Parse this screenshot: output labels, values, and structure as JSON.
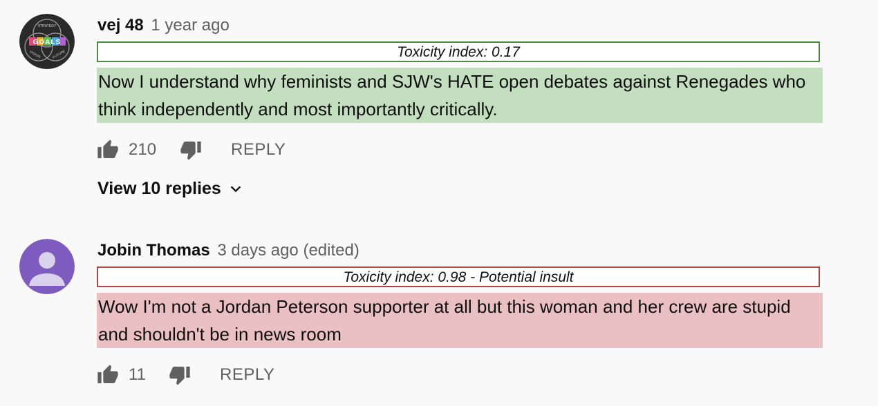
{
  "comments": [
    {
      "author": "vej 48",
      "time": "1 year ago",
      "toxicity_label": "Toxicity index: 0.17",
      "toxicity_color": "#4f8b3d",
      "highlight_color": "#c4dfbf",
      "text": "Now I understand why feminists and SJW's HATE open debates against Renegades who think independently and most importantly critically.",
      "likes": "210",
      "reply_label": "REPLY",
      "view_replies": "View 10 replies",
      "avatar": {
        "type": "logo",
        "lines": [
          "STRATEGY",
          "GOALS",
          "VISION",
          "FUTURE"
        ]
      }
    },
    {
      "author": "Jobin Thomas",
      "time": "3 days ago (edited)",
      "toxicity_label": "Toxicity index: 0.98 - Potential insult",
      "toxicity_color": "#b2433f",
      "highlight_color": "#ebc0c2",
      "text": "Wow I'm not a Jordan Peterson supporter at all but this woman and her crew are stupid and shouldn't be in news room",
      "likes": "11",
      "reply_label": "REPLY",
      "avatar": {
        "type": "default-person",
        "color": "#7e5bbf"
      }
    }
  ]
}
